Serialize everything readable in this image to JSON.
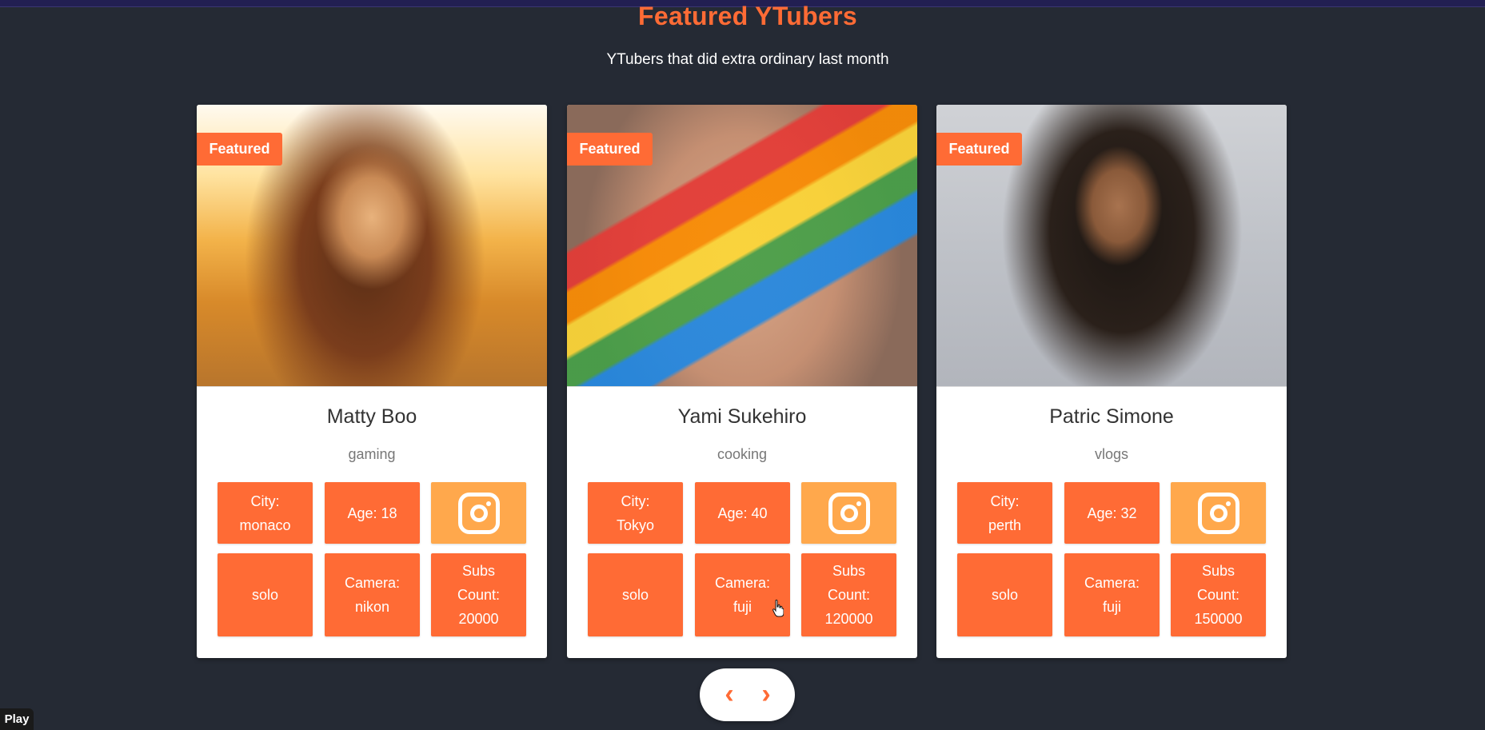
{
  "header": {
    "title": "Featured YTubers",
    "subtitle": "YTubers that did extra ordinary last month"
  },
  "colors": {
    "accent": "#ff6b35",
    "instagram_tile": "#ffa84c",
    "background": "#252a34"
  },
  "cards": [
    {
      "badge": "Featured",
      "name": "Matty Boo",
      "category": "gaming",
      "city_label": "City:",
      "city": "monaco",
      "age": "Age: 18",
      "instagram_icon": "instagram-icon",
      "mode": "solo",
      "camera_label": "Camera:",
      "camera": "nikon",
      "subs_label_1": "Subs",
      "subs_label_2": "Count:",
      "subs": "20000"
    },
    {
      "badge": "Featured",
      "name": "Yami Sukehiro",
      "category": "cooking",
      "city_label": "City:",
      "city": "Tokyo",
      "age": "Age: 40",
      "instagram_icon": "instagram-icon",
      "mode": "solo",
      "camera_label": "Camera:",
      "camera": "fuji",
      "subs_label_1": "Subs",
      "subs_label_2": "Count:",
      "subs": "120000"
    },
    {
      "badge": "Featured",
      "name": "Patric Simone",
      "category": "vlogs",
      "city_label": "City:",
      "city": "perth",
      "age": "Age: 32",
      "instagram_icon": "instagram-icon",
      "mode": "solo",
      "camera_label": "Camera:",
      "camera": "fuji",
      "subs_label_1": "Subs",
      "subs_label_2": "Count:",
      "subs": "150000"
    }
  ],
  "nav": {
    "prev": "‹",
    "next": "›",
    "prev_icon": "chevron-left-icon",
    "next_icon": "chevron-right-icon"
  },
  "player": {
    "play_label": "Play"
  }
}
